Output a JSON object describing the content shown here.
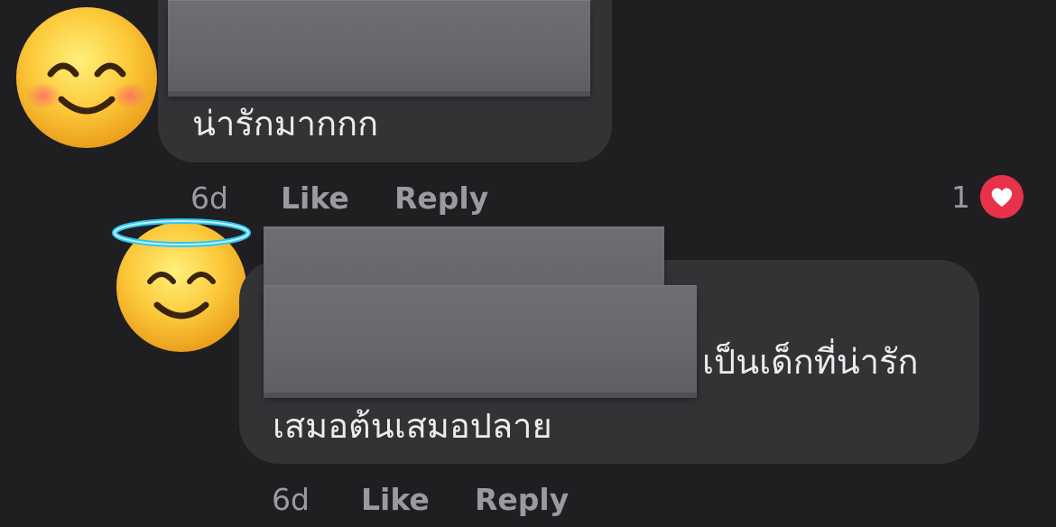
{
  "comments": [
    {
      "avatar": "smiling-face-with-smiling-eyes",
      "text_lines": [
        "น่ารักมากกก"
      ],
      "time": "6d",
      "like_label": "Like",
      "reply_label": "Reply",
      "reaction": {
        "count": "1",
        "icon": "heart-icon",
        "color": "#e8324a"
      }
    },
    {
      "avatar": "smiling-face-with-halo",
      "text_lines": [
        "เป็นเด็กที่น่ารัก",
        "เสมอต้นเสมอปลาย"
      ],
      "time": "6d",
      "like_label": "Like",
      "reply_label": "Reply"
    }
  ],
  "colors": {
    "background": "#1f1f21",
    "bubble": "#333336",
    "meta": "#9a9aa0",
    "halo": "#2ec7f0"
  }
}
